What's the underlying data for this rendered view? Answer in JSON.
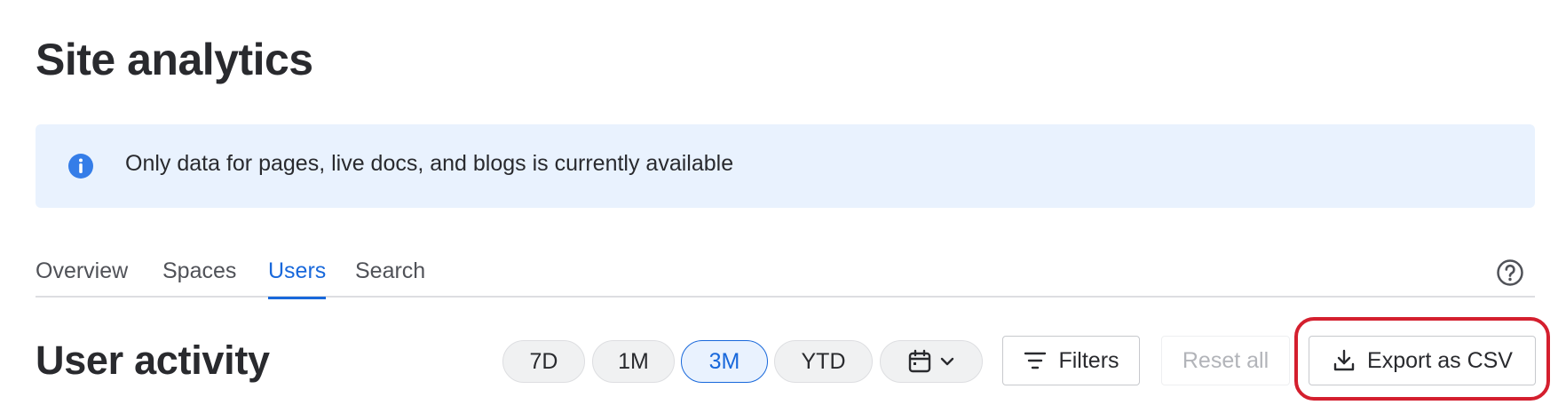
{
  "header": {
    "title": "Site analytics"
  },
  "banner": {
    "icon": "info-icon",
    "text": "Only data for pages, live docs, and blogs is currently available",
    "color": "#e9f2fe",
    "icon_color": "#357de8"
  },
  "tabs": [
    {
      "label": "Overview",
      "active": false
    },
    {
      "label": "Spaces",
      "active": false
    },
    {
      "label": "Users",
      "active": true
    },
    {
      "label": "Search",
      "active": false
    }
  ],
  "help": {
    "icon": "help-circle-icon"
  },
  "section": {
    "title": "User activity"
  },
  "date_range": {
    "options": [
      "7D",
      "1M",
      "3M",
      "YTD"
    ],
    "selected": "3M",
    "custom_icon": "calendar-icon",
    "custom_caret_icon": "chevron-down-icon"
  },
  "actions": {
    "filters_label": "Filters",
    "filters_icon": "filter-icon",
    "reset_label": "Reset all",
    "export_label": "Export as CSV",
    "export_icon": "download-icon"
  },
  "colors": {
    "accent": "#1868db",
    "highlight": "#d41f2e"
  }
}
